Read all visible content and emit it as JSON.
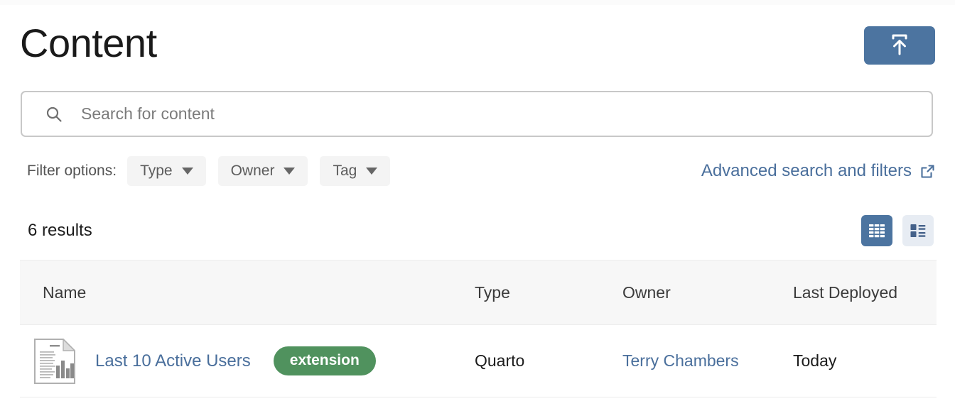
{
  "header": {
    "title": "Content",
    "upload_button": {
      "name": "publish-upload-button",
      "icon": "upload-to-tray-icon",
      "color": "#4c74a0"
    }
  },
  "search": {
    "placeholder": "Search for content",
    "value": "",
    "icon": "search-icon"
  },
  "filters": {
    "label": "Filter options:",
    "options": [
      {
        "label": "Type"
      },
      {
        "label": "Owner"
      },
      {
        "label": "Tag"
      }
    ],
    "advanced_link": {
      "label": "Advanced search and filters",
      "icon": "external-link-icon",
      "color": "#4a6f9c"
    }
  },
  "results": {
    "count_label": "6 results",
    "views": [
      {
        "name": "grid-view",
        "icon": "grid-view-icon",
        "active": true
      },
      {
        "name": "list-view",
        "icon": "list-view-icon",
        "active": false
      }
    ]
  },
  "table": {
    "columns": [
      "Name",
      "Type",
      "Owner",
      "Last Deployed"
    ],
    "rows": [
      {
        "icon": "document-report-icon",
        "name": "Last 10 Active Users",
        "tag": "extension",
        "tag_color": "#50925e",
        "type": "Quarto",
        "owner": "Terry Chambers",
        "last_deployed": "Today"
      }
    ]
  }
}
